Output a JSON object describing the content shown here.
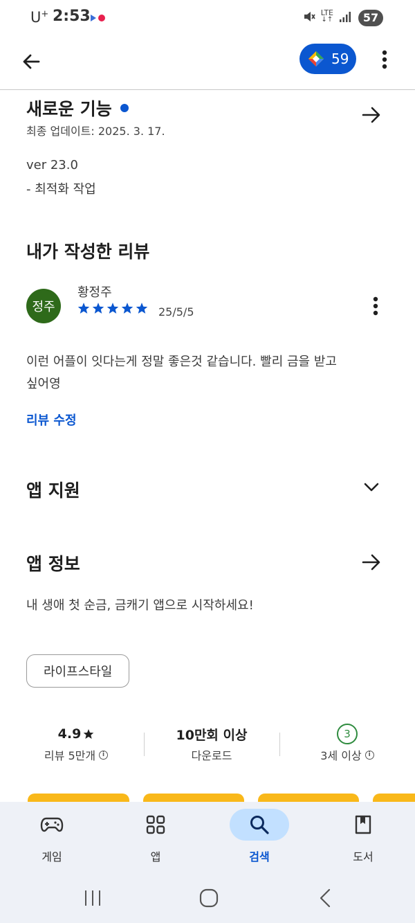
{
  "status_bar": {
    "carrier": "U",
    "carrier_sup": "+",
    "time": "2:53",
    "network": "LTE",
    "battery": "57"
  },
  "app_bar": {
    "points": "59"
  },
  "whats_new": {
    "title": "새로운 기능",
    "last_updated": "최종 업데이트: 2025. 3. 17.",
    "version": "ver 23.0",
    "note": "- 최적화 작업"
  },
  "my_review": {
    "title": "내가 작성한 리뷰",
    "avatar_text": "정주",
    "author": "황정주",
    "rating": 5,
    "date": "25/5/5",
    "text_line1": "이런 어플이 잇다는게 정말 좋은것 같습니다. 빨리 금을 받고",
    "text_line2": "싶어영",
    "edit_label": "리뷰 수정"
  },
  "app_support": {
    "title": "앱 지원"
  },
  "app_info": {
    "title": "앱 정보",
    "description": "내 생애 첫 순금, 금캐기 앱으로 시작하세요!",
    "category_chip": "라이프스타일"
  },
  "stats": {
    "rating_value": "4.9",
    "rating_label": "리뷰 5만개",
    "downloads_value": "10만회 이상",
    "downloads_label": "다운로드",
    "age_value": "3",
    "age_label": "3세 이상"
  },
  "bottom_nav": {
    "items": [
      {
        "label": "게임",
        "icon": "gamepad-icon"
      },
      {
        "label": "앱",
        "icon": "apps-grid-icon"
      },
      {
        "label": "검색",
        "icon": "search-icon"
      },
      {
        "label": "도서",
        "icon": "book-icon"
      }
    ],
    "active_index": 2
  },
  "colors": {
    "accent": "#0b57d0",
    "avatar": "#2e6a1a",
    "age_badge": "#2e8b3e",
    "nav_bg": "#eef1f7",
    "nav_active": "#c2e0ff",
    "promo": "#f9b81a"
  }
}
